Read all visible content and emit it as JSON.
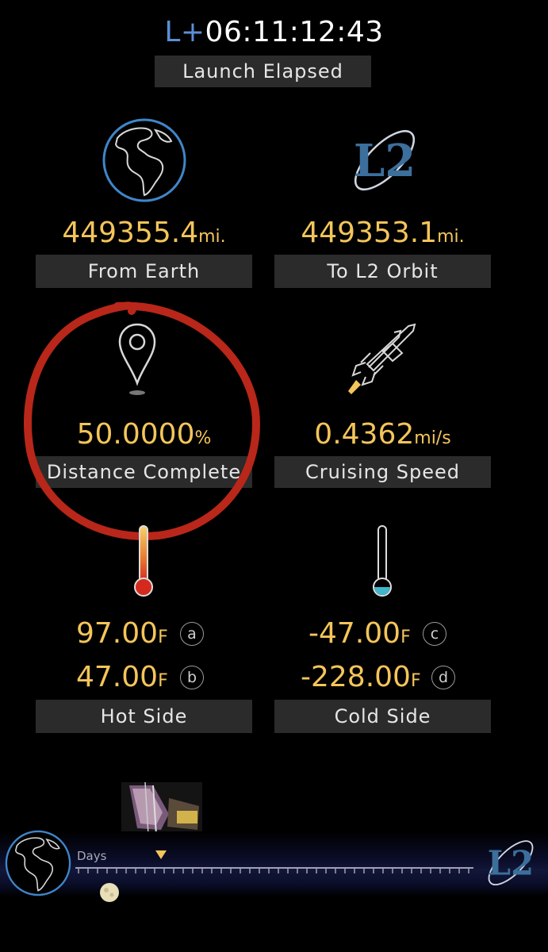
{
  "header": {
    "prefix": "L+",
    "elapsed_time": "06:11:12:43",
    "label": "Launch Elapsed"
  },
  "stats": {
    "from_earth": {
      "value": "449355.4",
      "unit": "mi.",
      "label": "From Earth",
      "icon": "earth-icon"
    },
    "to_l2": {
      "value": "449353.1",
      "unit": "mi.",
      "label": "To L2 Orbit",
      "icon": "l2-logo-icon",
      "logo_text": "L2"
    },
    "distance_complete": {
      "value": "50.0000",
      "unit": "%",
      "label": "Distance Complete",
      "icon": "location-pin-icon"
    },
    "cruising_speed": {
      "value": "0.4362",
      "unit": "mi/s",
      "label": "Cruising Speed",
      "icon": "rocket-icon"
    }
  },
  "temperatures": {
    "hot_side": {
      "label": "Hot Side",
      "icon": "hot-thermometer-icon",
      "readings": [
        {
          "value": "97.00",
          "unit": "F",
          "sensor": "a"
        },
        {
          "value": "47.00",
          "unit": "F",
          "sensor": "b"
        }
      ]
    },
    "cold_side": {
      "label": "Cold Side",
      "icon": "cold-thermometer-icon",
      "readings": [
        {
          "value": "-47.00",
          "unit": "F",
          "sensor": "c"
        },
        {
          "value": "-228.00",
          "unit": "F",
          "sensor": "d"
        }
      ]
    }
  },
  "timeline": {
    "axis_label": "Days",
    "start_icon": "earth-icon",
    "end_icon": "l2-logo-icon",
    "end_logo_text": "L2",
    "marker_icon": "marker-triangle-icon",
    "moon_icon": "moon-icon",
    "thumbnail_icon": "telescope-deployment-thumbnail"
  },
  "annotation": {
    "color": "#b8271a",
    "description_icon": "red-circle-annotation"
  },
  "colors": {
    "value": "#f4c55a",
    "prefix": "#5b8fd6",
    "label_box": "#2b2b2b",
    "earth_ring": "#3f86c9"
  }
}
